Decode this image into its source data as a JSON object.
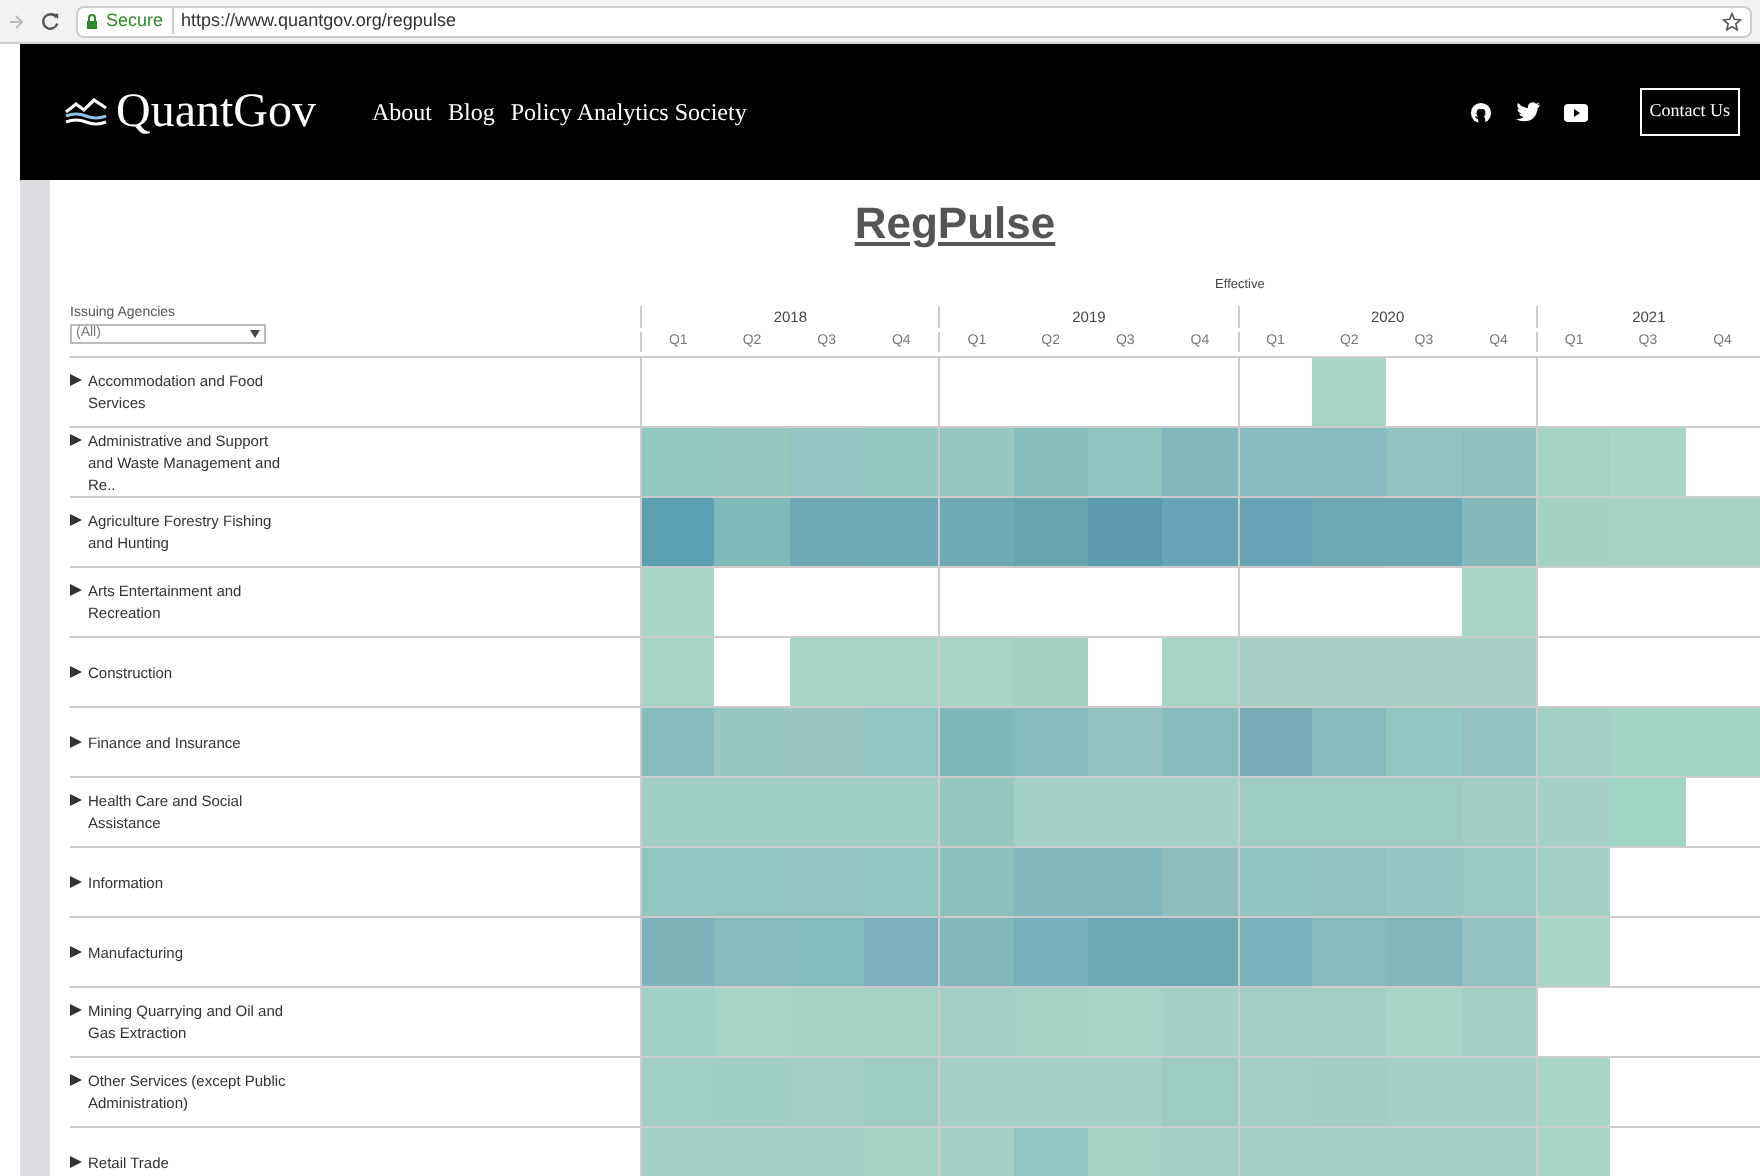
{
  "browser": {
    "secure_label": "Secure",
    "url": "https://www.quantgov.org/regpulse"
  },
  "navbar": {
    "brand": "QuantGov",
    "links": [
      "About",
      "Blog",
      "Policy Analytics Society"
    ],
    "contact": "Contact Us"
  },
  "title": "RegPulse",
  "filter": {
    "label": "Issuing Agencies",
    "value": "(All)"
  },
  "column_header": {
    "title": "Effective",
    "years": [
      {
        "label": "2018",
        "quarters": [
          "Q1",
          "Q2",
          "Q3",
          "Q4"
        ]
      },
      {
        "label": "2019",
        "quarters": [
          "Q1",
          "Q2",
          "Q3",
          "Q4"
        ]
      },
      {
        "label": "2020",
        "quarters": [
          "Q1",
          "Q2",
          "Q3",
          "Q4"
        ]
      },
      {
        "label": "2021",
        "quarters": [
          "Q1",
          "Q3",
          "Q4"
        ]
      }
    ]
  },
  "rows": [
    {
      "label": "Accommodation and Food Services",
      "cells": [
        null,
        null,
        null,
        null,
        null,
        null,
        null,
        null,
        null,
        {
          "color": "#a8d6c6"
        },
        null,
        null,
        null,
        null,
        null
      ]
    },
    {
      "label": "Administrative and Support and Waste Management and Re..",
      "cells": [
        {
          "color": "#93c8c0"
        },
        {
          "color": "#98c9c1"
        },
        {
          "color": "#95c5c2"
        },
        {
          "color": "#96c9c2"
        },
        {
          "color": "#98c8c0"
        },
        {
          "color": "#88bfbd"
        },
        {
          "color": "#8ec3be"
        },
        {
          "color": "#82b8bd"
        },
        {
          "color": "#88bcbd"
        },
        {
          "color": "#8abbbe"
        },
        {
          "color": "#93c3bf"
        },
        {
          "color": "#8fc0be"
        },
        {
          "color": "#a6d2c6"
        },
        {
          "color": "#a8d6c6"
        },
        null
      ]
    },
    {
      "label": "Agriculture Forestry Fishing and Hunting",
      "cells": [
        {
          "color": "#5c9fb0"
        },
        {
          "color": "#80b8bb"
        },
        {
          "color": "#70a9b6"
        },
        {
          "color": "#6ea9b6"
        },
        {
          "color": "#70a9b6"
        },
        {
          "color": "#68a5b3"
        },
        {
          "color": "#5b9bae"
        },
        {
          "color": "#68a5b4"
        },
        {
          "color": "#68a5b4"
        },
        {
          "color": "#6fa8b5"
        },
        {
          "color": "#70a9b6"
        },
        {
          "color": "#85b8bb"
        },
        {
          "color": "#a5d1c5"
        },
        {
          "color": "#a6d3c6"
        },
        {
          "color": "#a6d3c6"
        }
      ]
    },
    {
      "label": "Arts Entertainment and Recreation",
      "cells": [
        {
          "color": "#a8d6c6"
        },
        null,
        null,
        null,
        null,
        null,
        null,
        null,
        null,
        null,
        null,
        {
          "color": "#a8d6c6"
        },
        null,
        null,
        null
      ]
    },
    {
      "label": "Construction",
      "cells": [
        {
          "color": "#a6d4c5"
        },
        null,
        {
          "color": "#a6d4c6"
        },
        {
          "color": "#a6d4c6"
        },
        {
          "color": "#a6d4c6"
        },
        {
          "color": "#a3d1c4"
        },
        null,
        {
          "color": "#a6d4c6"
        },
        {
          "color": "#a6d0c6"
        },
        {
          "color": "#a6d0c6"
        },
        {
          "color": "#a6d0c6"
        },
        {
          "color": "#a6d0c6"
        },
        null,
        null,
        null
      ]
    },
    {
      "label": "Finance and Insurance",
      "cells": [
        {
          "color": "#89bdbd"
        },
        {
          "color": "#99c7c2"
        },
        {
          "color": "#9ac7c2"
        },
        {
          "color": "#93c5c2"
        },
        {
          "color": "#80b7bb"
        },
        {
          "color": "#86bbbd"
        },
        {
          "color": "#93c2c0"
        },
        {
          "color": "#88bdbd"
        },
        {
          "color": "#78adb8"
        },
        {
          "color": "#88bcbd"
        },
        {
          "color": "#93c7c2"
        },
        {
          "color": "#93c2c0"
        },
        {
          "color": "#a3cfc4"
        },
        {
          "color": "#a3d4c6"
        },
        {
          "color": "#a3d4c6"
        }
      ]
    },
    {
      "label": "Health Care and Social Assistance",
      "cells": [
        {
          "color": "#9fcfc4"
        },
        {
          "color": "#9fcfc4"
        },
        {
          "color": "#9fcfc4"
        },
        {
          "color": "#9fcfc4"
        },
        {
          "color": "#97c9c1"
        },
        {
          "color": "#a3d1c6"
        },
        {
          "color": "#a3d1c6"
        },
        {
          "color": "#a3d1c6"
        },
        {
          "color": "#9ccbc2"
        },
        {
          "color": "#9ccbc2"
        },
        {
          "color": "#9ccbc2"
        },
        {
          "color": "#a0cdc4"
        },
        {
          "color": "#a5d0c6"
        },
        {
          "color": "#a0d4c5"
        },
        null
      ]
    },
    {
      "label": "Information",
      "cells": [
        {
          "color": "#92c6c0"
        },
        {
          "color": "#92c6c0"
        },
        {
          "color": "#95c5c1"
        },
        {
          "color": "#92c6c0"
        },
        {
          "color": "#8cc0be"
        },
        {
          "color": "#83b8bc"
        },
        {
          "color": "#83b8bc"
        },
        {
          "color": "#8ebdbd"
        },
        {
          "color": "#91c3c0"
        },
        {
          "color": "#94c2c1"
        },
        {
          "color": "#97c7c2"
        },
        {
          "color": "#9ac8c2"
        },
        {
          "color": "#a3cfc4"
        },
        null,
        null
      ]
    },
    {
      "label": "Manufacturing",
      "cells": [
        {
          "color": "#7fb2bb"
        },
        {
          "color": "#88bbbe"
        },
        {
          "color": "#83bcbb"
        },
        {
          "color": "#7bafbb"
        },
        {
          "color": "#83b9bc"
        },
        {
          "color": "#78afb9"
        },
        {
          "color": "#6fa9b6"
        },
        {
          "color": "#6fa9b6"
        },
        {
          "color": "#7ab1bb"
        },
        {
          "color": "#86bbbc"
        },
        {
          "color": "#84b7bc"
        },
        {
          "color": "#93c1c0"
        },
        {
          "color": "#a8d6c6"
        },
        null,
        null
      ]
    },
    {
      "label": "Mining Quarrying and Oil and Gas Extraction",
      "cells": [
        {
          "color": "#a0cfc4"
        },
        {
          "color": "#a6d5c6"
        },
        {
          "color": "#a4d2c5"
        },
        {
          "color": "#a4d2c5"
        },
        {
          "color": "#a2d0c4"
        },
        {
          "color": "#a4d2c5"
        },
        {
          "color": "#a6d4c6"
        },
        {
          "color": "#a4d1c5"
        },
        {
          "color": "#a2cfc4"
        },
        {
          "color": "#a2cfc4"
        },
        {
          "color": "#a8d6c6"
        },
        {
          "color": "#a2cfc4"
        },
        null,
        null,
        null
      ]
    },
    {
      "label": "Other Services (except Public Administration)",
      "cells": [
        {
          "color": "#a0cfc4"
        },
        {
          "color": "#9fcec4"
        },
        {
          "color": "#a2d0c5"
        },
        {
          "color": "#9ccbc1"
        },
        {
          "color": "#a3d1c6"
        },
        {
          "color": "#a3d1c6"
        },
        {
          "color": "#a3d1c6"
        },
        {
          "color": "#9ccbc1"
        },
        {
          "color": "#a1cfc4"
        },
        {
          "color": "#a1cdc4"
        },
        {
          "color": "#a3d1c6"
        },
        {
          "color": "#a3d1c6"
        },
        {
          "color": "#a8d6c6"
        },
        null,
        null
      ]
    },
    {
      "label": "Retail Trade",
      "cells": [
        {
          "color": "#a4d1c6"
        },
        {
          "color": "#a4d1c6"
        },
        {
          "color": "#a4d1c6"
        },
        {
          "color": "#a6d2c6"
        },
        {
          "color": "#a4d1c6"
        },
        {
          "color": "#93c5c0"
        },
        {
          "color": "#a6d2c6"
        },
        {
          "color": "#a3d0c5"
        },
        {
          "color": "#a3d0c5"
        },
        {
          "color": "#a3d0c5"
        },
        {
          "color": "#a1cfc4"
        },
        {
          "color": "#a3d0c5"
        },
        {
          "color": "#a6d5c6"
        },
        null,
        null
      ]
    }
  ]
}
